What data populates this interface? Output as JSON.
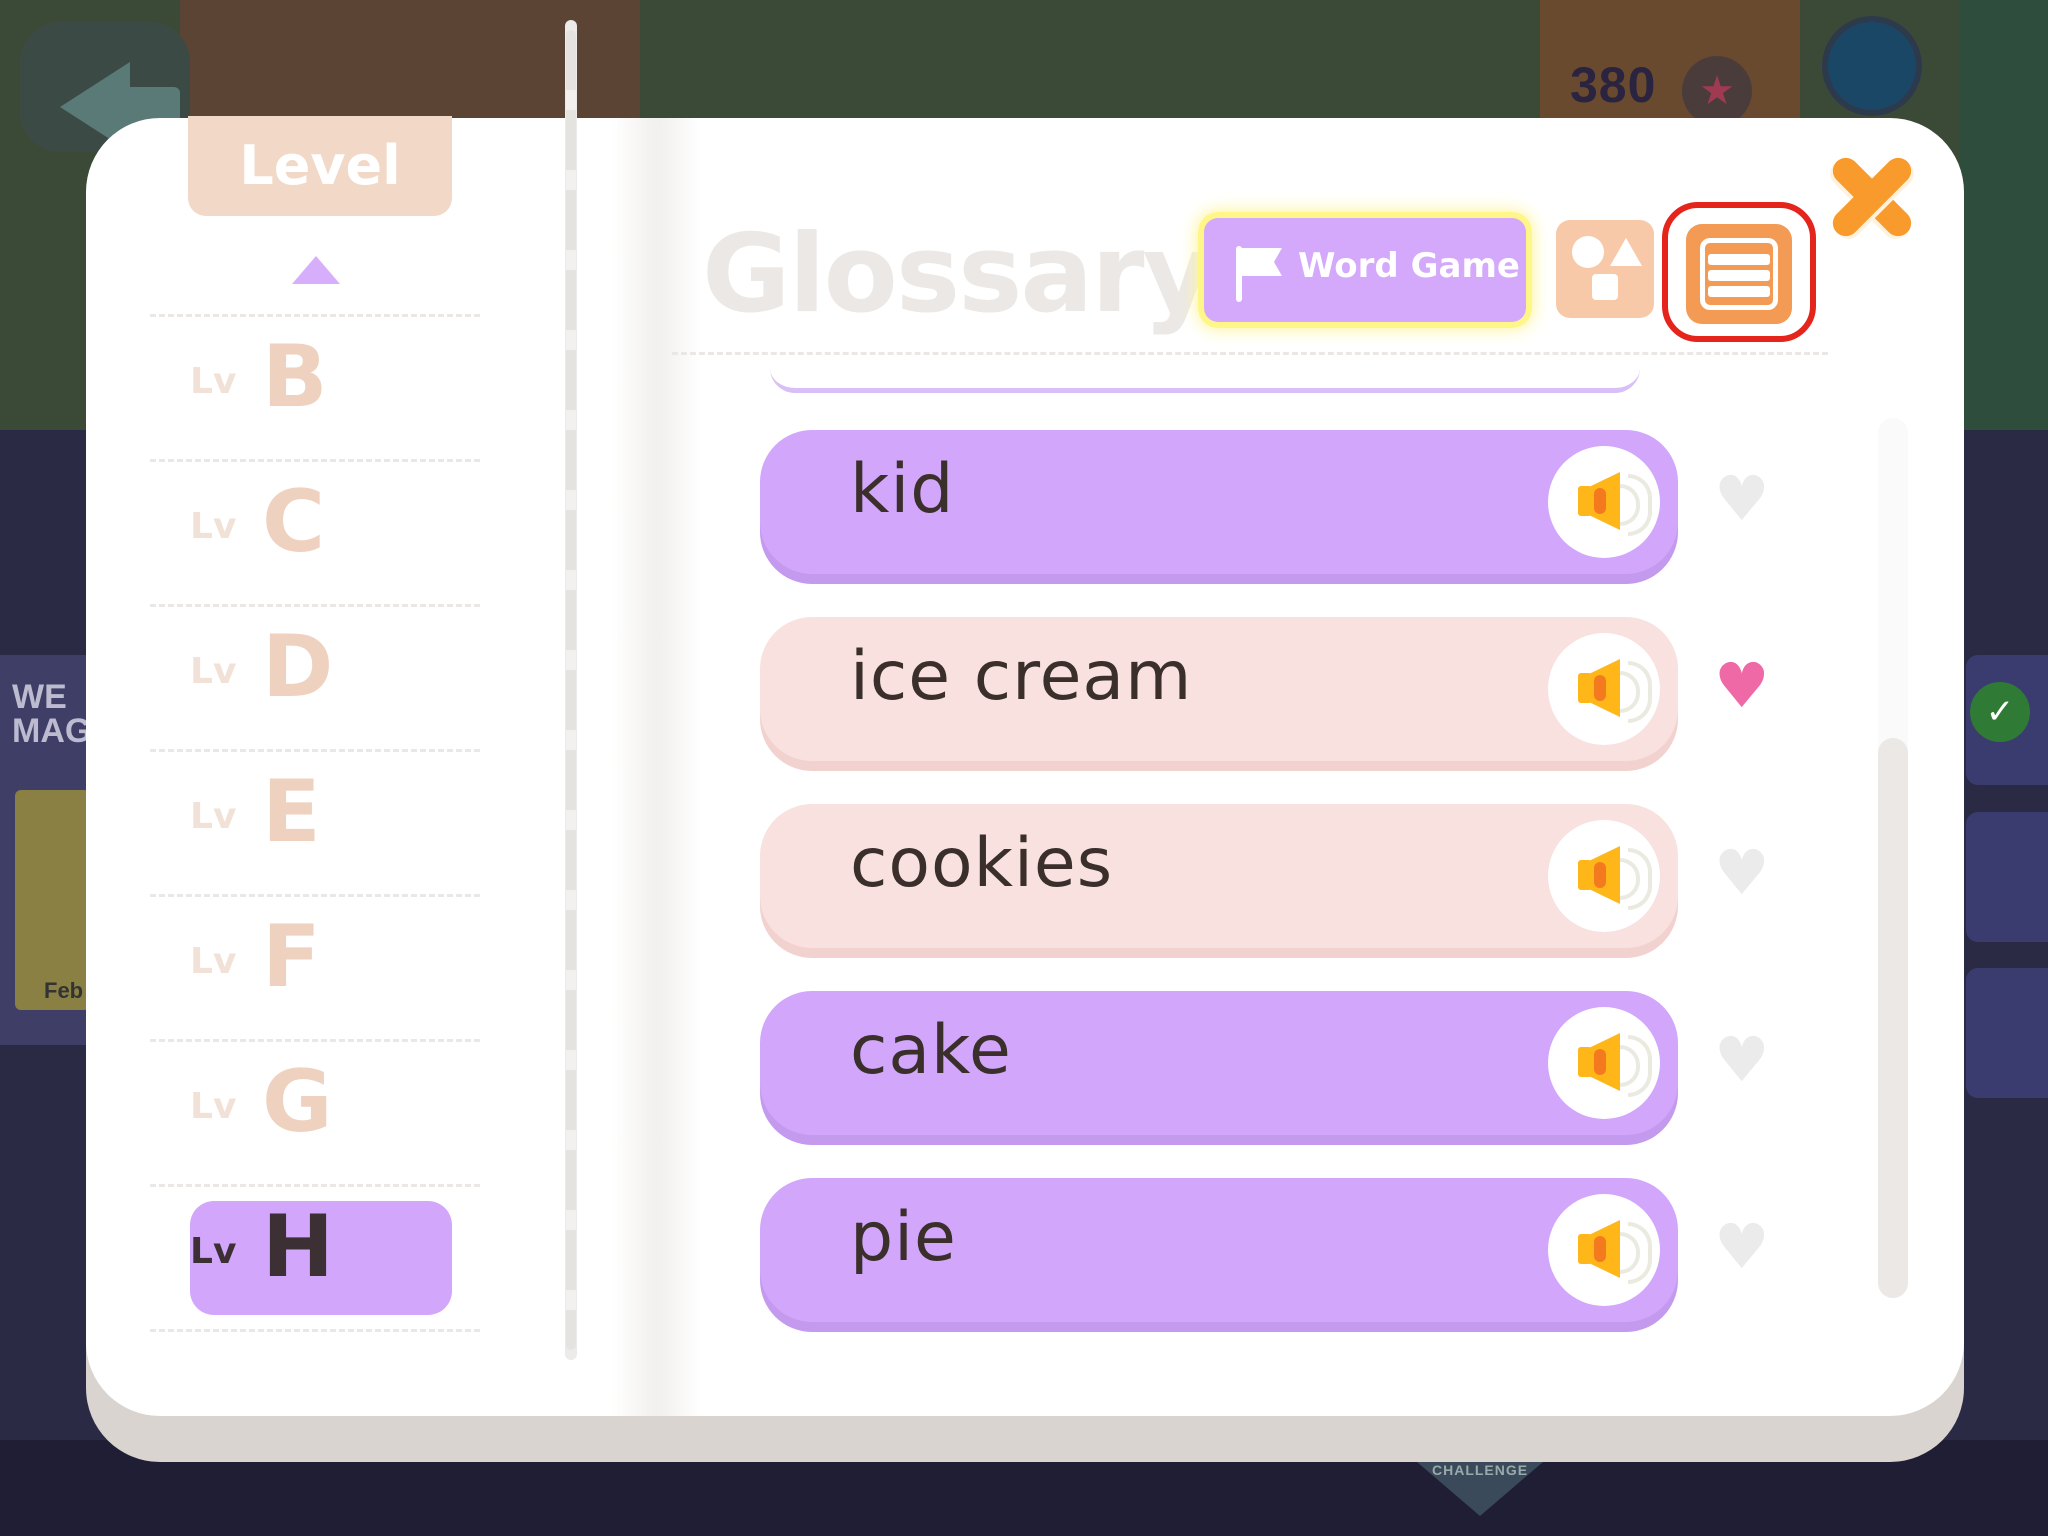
{
  "background": {
    "score": "380",
    "side_card_text": "WE\nMAG",
    "side_card_date": "Feb",
    "challenge_label": "CHALLENGE"
  },
  "level_panel": {
    "title": "Level",
    "items": [
      {
        "prefix": "Lv",
        "letter": "B",
        "selected": false
      },
      {
        "prefix": "Lv",
        "letter": "C",
        "selected": false
      },
      {
        "prefix": "Lv",
        "letter": "D",
        "selected": false
      },
      {
        "prefix": "Lv",
        "letter": "E",
        "selected": false
      },
      {
        "prefix": "Lv",
        "letter": "F",
        "selected": false
      },
      {
        "prefix": "Lv",
        "letter": "G",
        "selected": false
      },
      {
        "prefix": "Lv",
        "letter": "H",
        "selected": true
      }
    ]
  },
  "header": {
    "title": "Glossary",
    "word_game_label": "Word Game"
  },
  "words": [
    {
      "word": "kid",
      "style": "purple",
      "favorite": false
    },
    {
      "word": "ice cream",
      "style": "pink",
      "favorite": true
    },
    {
      "word": "cookies",
      "style": "pink",
      "favorite": false
    },
    {
      "word": "cake",
      "style": "purple",
      "favorite": false
    },
    {
      "word": "pie",
      "style": "purple",
      "favorite": false
    }
  ],
  "colors": {
    "purple_row": "#d1a6fb",
    "pink_row": "#f8e1df",
    "heart_on": "#ef69a6",
    "heart_off": "#ebebeb",
    "accent_orange": "#f39a54",
    "highlight_red": "#e5241b"
  },
  "icons": [
    "back-arrow-icon",
    "star-icon",
    "globe-icon",
    "flag-icon",
    "shapes-icon",
    "list-icon",
    "close-icon",
    "speaker-icon",
    "heart-icon",
    "chevron-up-icon"
  ]
}
